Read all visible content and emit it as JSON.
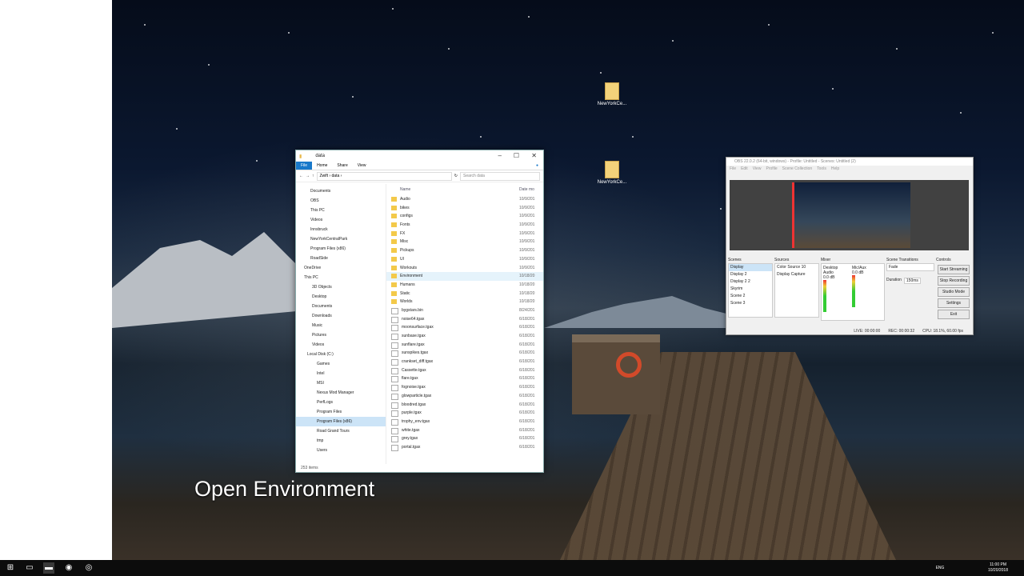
{
  "caption": "Open Environment",
  "desktop_icons": [
    {
      "label": "NewYorkCe..."
    },
    {
      "label": "NewYorkCe..."
    }
  ],
  "explorer": {
    "title": "data",
    "ribbon": [
      "File",
      "Home",
      "Share",
      "View"
    ],
    "path": [
      "Zwift",
      "data"
    ],
    "search_placeholder": "Search data",
    "columns": {
      "name": "Name",
      "date": "Date mo"
    },
    "nav_items": [
      "Documents",
      "OBS",
      "This PC",
      "Videos",
      "Innsbruck",
      "NewYorkCentralPark",
      "Program Files (x86)",
      "RoadSide",
      "OneDrive",
      "This PC",
      "3D Objects",
      "Desktop",
      "Documents",
      "Downloads",
      "Music",
      "Pictures",
      "Videos",
      "Local Disk (C:)",
      "Games",
      "Intel",
      "MSI",
      "Nexus Mod Manager",
      "PerfLogs",
      "Program Files",
      "Program Files (x86)",
      "Road Grand Tours",
      "tmp",
      "Users"
    ],
    "nav_selected_index": 24,
    "files": [
      {
        "name": "Audio",
        "date": "10/9/201",
        "type": "folder"
      },
      {
        "name": "bikes",
        "date": "10/9/201",
        "type": "folder"
      },
      {
        "name": "configs",
        "date": "10/9/201",
        "type": "folder"
      },
      {
        "name": "Fonts",
        "date": "10/9/201",
        "type": "folder"
      },
      {
        "name": "FX",
        "date": "10/9/201",
        "type": "folder"
      },
      {
        "name": "Misc",
        "date": "10/9/201",
        "type": "folder"
      },
      {
        "name": "Pickups",
        "date": "10/9/201",
        "type": "folder"
      },
      {
        "name": "UI",
        "date": "10/9/201",
        "type": "folder"
      },
      {
        "name": "Workouts",
        "date": "10/9/201",
        "type": "folder"
      },
      {
        "name": "Environment",
        "date": "10/18/20",
        "type": "folder"
      },
      {
        "name": "Humans",
        "date": "10/18/20",
        "type": "folder"
      },
      {
        "name": "Static",
        "date": "10/18/20",
        "type": "folder"
      },
      {
        "name": "Worlds",
        "date": "10/18/20",
        "type": "folder"
      },
      {
        "name": "bygstars.bin",
        "date": "8/24/201",
        "type": "file"
      },
      {
        "name": "noise64.tgax",
        "date": "6/18/201",
        "type": "file"
      },
      {
        "name": "moonsurface.tgax",
        "date": "6/18/201",
        "type": "file"
      },
      {
        "name": "sunbase.tgax",
        "date": "6/18/201",
        "type": "file"
      },
      {
        "name": "sunflare.tgax",
        "date": "6/18/201",
        "type": "file"
      },
      {
        "name": "sunspikes.tgax",
        "date": "6/18/201",
        "type": "file"
      },
      {
        "name": "crankset_diff.tgax",
        "date": "6/18/201",
        "type": "file"
      },
      {
        "name": "Cassette.tgax",
        "date": "6/18/201",
        "type": "file"
      },
      {
        "name": "flare.tgax",
        "date": "6/18/201",
        "type": "file"
      },
      {
        "name": "fognoise.tgax",
        "date": "6/18/201",
        "type": "file"
      },
      {
        "name": "glowparticle.tgax",
        "date": "6/18/201",
        "type": "file"
      },
      {
        "name": "bloodred.tgax",
        "date": "6/18/201",
        "type": "file"
      },
      {
        "name": "purple.tgax",
        "date": "6/18/201",
        "type": "file"
      },
      {
        "name": "trophy_env.tgax",
        "date": "6/18/201",
        "type": "file"
      },
      {
        "name": "white.tgax",
        "date": "6/18/201",
        "type": "file"
      },
      {
        "name": "grey.tgax",
        "date": "6/18/201",
        "type": "file"
      },
      {
        "name": "portal.tgax",
        "date": "6/18/201",
        "type": "file"
      }
    ],
    "highlighted_index": 9,
    "status": "253 items"
  },
  "obs": {
    "title": "OBS 22.0.2 (64-bit, windows) - Profile: Untitled - Scenes: Untitled (2)",
    "menu": [
      "File",
      "Edit",
      "View",
      "Profile",
      "Scene Collection",
      "Tools",
      "Help"
    ],
    "panels": {
      "scenes": {
        "title": "Scenes",
        "items": [
          "Display",
          "Display 2",
          "Display 2 2",
          "Skyrim",
          "Scene 2",
          "Scene 3"
        ]
      },
      "sources": {
        "title": "Sources",
        "items": [
          "Color Source 10",
          "Display Capture"
        ]
      },
      "mixer": {
        "title": "Mixer",
        "items": [
          "Desktop Audio",
          "Mic/Aux"
        ],
        "levels": [
          "0.0 dB",
          "0.0 dB"
        ]
      },
      "transitions": {
        "title": "Scene Transitions",
        "fade": "Fade",
        "duration_label": "Duration",
        "duration": "150ms"
      },
      "controls": {
        "title": "Controls",
        "buttons": [
          "Start Streaming",
          "Stop Recording",
          "Studio Mode",
          "Settings",
          "Exit"
        ]
      }
    },
    "status": {
      "live": "LIVE: 00:00:00",
      "rec": "REC: 00:00:32",
      "cpu": "CPU: 18.1%, 60.00 fps"
    }
  },
  "taskbar": {
    "time": "11:00 PM",
    "date": "10/20/2018",
    "lang": "ENG"
  }
}
